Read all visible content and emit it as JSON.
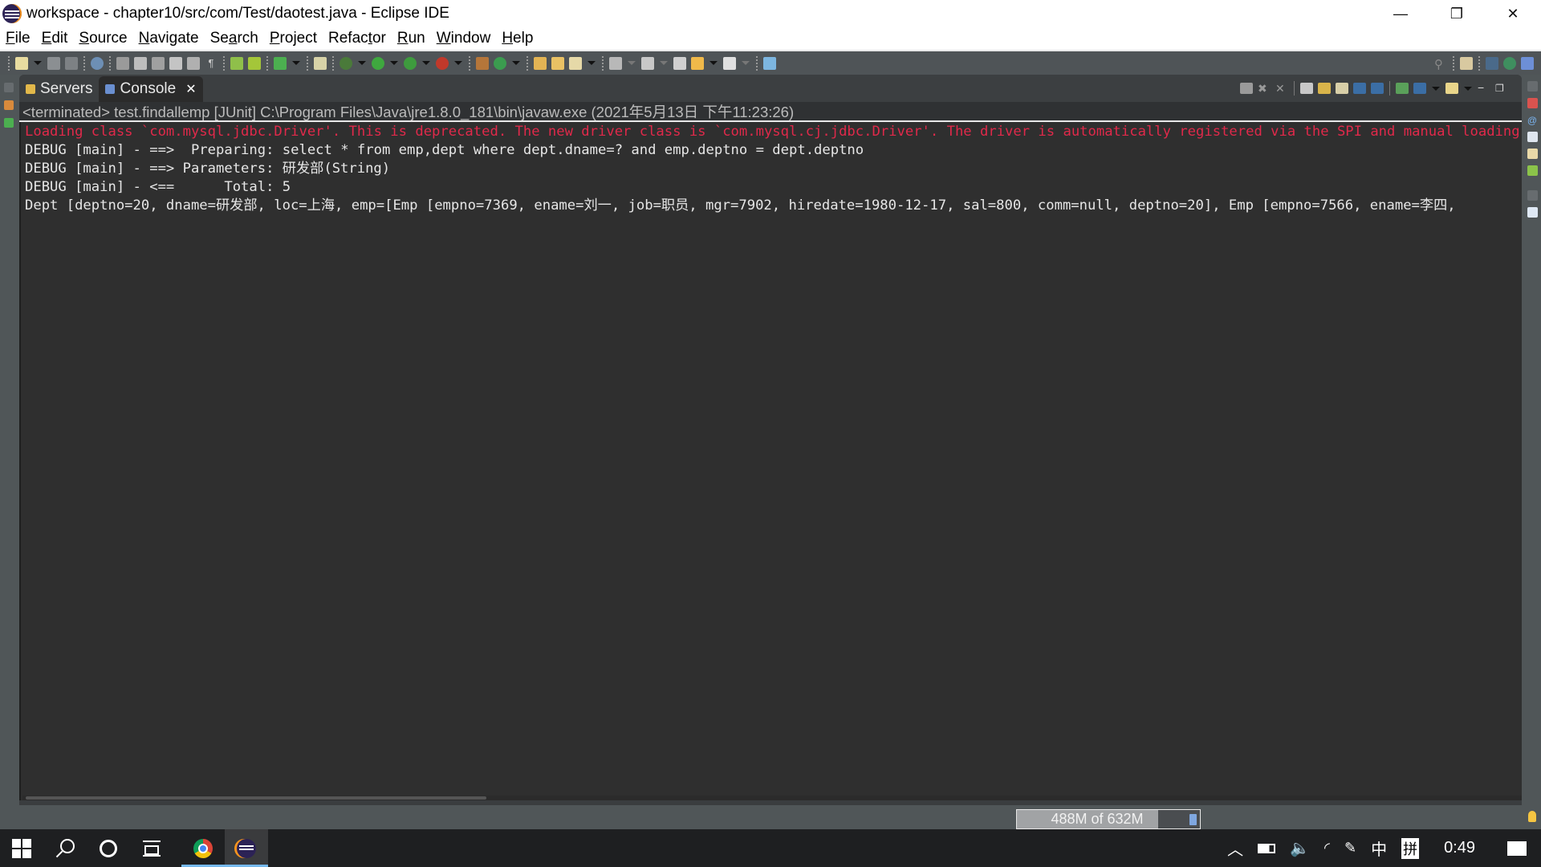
{
  "window": {
    "title": "workspace - chapter10/src/com/Test/daotest.java - Eclipse IDE",
    "controls": [
      "minimize",
      "restore",
      "close"
    ]
  },
  "menubar": {
    "items": [
      {
        "label": "File",
        "mnemonic": "F",
        "rest": "ile"
      },
      {
        "label": "Edit",
        "mnemonic": "E",
        "rest": "dit"
      },
      {
        "label": "Source",
        "mnemonic": "S",
        "rest": "ource"
      },
      {
        "label": "Navigate",
        "mnemonic": "N",
        "rest": "avigate"
      },
      {
        "label": "Search",
        "mnemonic": "a",
        "pre": "Se",
        "rest": "rch"
      },
      {
        "label": "Project",
        "mnemonic": "P",
        "rest": "roject"
      },
      {
        "label": "Refactor",
        "mnemonic": "t",
        "pre": "Refac",
        "rest": "or"
      },
      {
        "label": "Run",
        "mnemonic": "R",
        "rest": "un"
      },
      {
        "label": "Window",
        "mnemonic": "W",
        "rest": "indow"
      },
      {
        "label": "Help",
        "mnemonic": "H",
        "rest": "elp"
      }
    ]
  },
  "view": {
    "tabs": [
      {
        "label": "Servers",
        "active": false,
        "icon": "servers-icon"
      },
      {
        "label": "Console",
        "active": true,
        "icon": "console-icon",
        "closable": true
      }
    ],
    "close_glyph": "✕",
    "console_header": "<terminated> test.findallemp [JUnit] C:\\Program Files\\Java\\jre1.8.0_181\\bin\\javaw.exe (2021年5月13日 下午11:23:26)",
    "lines": [
      {
        "text": "Loading class `com.mysql.jdbc.Driver'. This is deprecated. The new driver class is `com.mysql.cj.jdbc.Driver'. The driver is automatically registered via the SPI and manual loading of the driver class is generally unnecessary.",
        "type": "error"
      },
      {
        "text": "DEBUG [main] - ==>  Preparing: select * from emp,dept where dept.dname=? and emp.deptno = dept.deptno",
        "type": "out"
      },
      {
        "text": "DEBUG [main] - ==> Parameters: 研发部(String)",
        "type": "out"
      },
      {
        "text": "DEBUG [main] - <==      Total: 5",
        "type": "out"
      },
      {
        "text": "Dept [deptno=20, dname=研发部, loc=上海, emp=[Emp [empno=7369, ename=刘一, job=职员, mgr=7902, hiredate=1980-12-17, sal=800, comm=null, deptno=20], Emp [empno=7566, ename=李四,",
        "type": "out"
      }
    ]
  },
  "statusbar": {
    "heap_label": "488M of 632M",
    "heap_used_fraction": 0.772
  },
  "taskbar": {
    "apps": [
      {
        "name": "start",
        "icon": "windows-logo-icon"
      },
      {
        "name": "search",
        "icon": "search-icon"
      },
      {
        "name": "cortana",
        "icon": "cortana-icon"
      },
      {
        "name": "task-view",
        "icon": "task-view-icon"
      },
      {
        "name": "chrome",
        "icon": "chrome-icon",
        "running": true
      },
      {
        "name": "eclipse",
        "icon": "eclipse-icon",
        "running": true,
        "active": true
      }
    ],
    "tray": {
      "chevron": "^",
      "ime_lang": "中",
      "ime_mode": "拼",
      "clock": "0:49"
    }
  }
}
